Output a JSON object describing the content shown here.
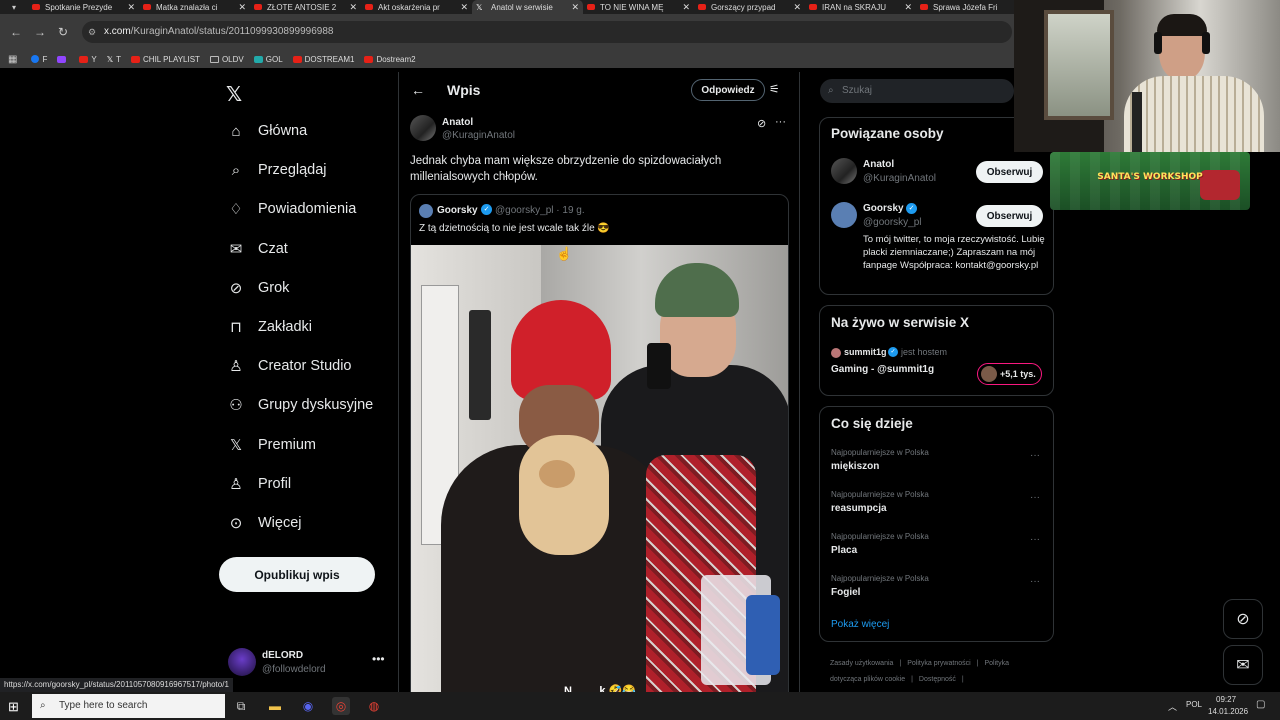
{
  "browser": {
    "tabs": [
      {
        "title": "Spotkanie Prezyde",
        "icon": "youtube-icon",
        "active": false
      },
      {
        "title": "Matka znalazła ci",
        "icon": "youtube-icon",
        "active": false
      },
      {
        "title": "ZŁOTE ANTOSIE 2",
        "icon": "youtube-icon",
        "active": false
      },
      {
        "title": "Akt oskarżenia pr",
        "icon": "youtube-icon",
        "active": false
      },
      {
        "title": "Anatol w serwisie",
        "icon": "x-icon",
        "active": true
      },
      {
        "title": "TO NIE WINA MĘ",
        "icon": "youtube-icon",
        "active": false
      },
      {
        "title": "Gorszący przypad",
        "icon": "youtube-icon",
        "active": false
      },
      {
        "title": "IRAN na SKRAJU",
        "icon": "youtube-icon",
        "active": false
      },
      {
        "title": "Sprawa Józefa Fri",
        "icon": "youtube-icon",
        "active": false
      }
    ],
    "url_host": "x.com",
    "url_path": "/KuraginAnatol/status/2011099930899996988",
    "bookmarks": [
      "F",
      "Y",
      "T",
      "CHIL PLAYLIST",
      "OLDV",
      "GOL",
      "DOSTREAM1",
      "Dostream2"
    ],
    "status_url": "https://x.com/goorsky_pl/status/2011057080916967517/photo/1"
  },
  "nav": {
    "items": [
      "Główna",
      "Przeglądaj",
      "Powiadomienia",
      "Czat",
      "Grok",
      "Zakładki",
      "Creator Studio",
      "Grupy dyskusyjne",
      "Premium",
      "Profil",
      "Więcej"
    ],
    "icons": [
      "home-icon",
      "search-icon",
      "bell-icon",
      "mail-icon",
      "grok-icon",
      "bookmark-icon",
      "creator-icon",
      "groups-icon",
      "x-icon",
      "profile-icon",
      "more-icon"
    ],
    "post_button": "Opublikuj wpis",
    "account_name": "dELORD",
    "account_handle": "@followdelord"
  },
  "main": {
    "title": "Wpis",
    "reply_button": "Odpowiedz",
    "author_name": "Anatol",
    "author_handle": "@KuraginAnatol",
    "text": "Jednak chyba mam większe obrzydzenie do spizdowaciałych millenialsowych chłopów.",
    "quote": {
      "name": "Goorsky",
      "handle": "@goorsky_pl",
      "time": "· 19 g.",
      "text": "Z tą dzietnością to nie jest wcale tak źle 😎"
    },
    "photo_caption": "N.........k 🤣😂"
  },
  "right": {
    "search_placeholder": "Szukaj",
    "related": {
      "title": "Powiązane osoby",
      "people": [
        {
          "name": "Anatol",
          "handle": "@KuraginAnatol",
          "button": "Obserwuj"
        },
        {
          "name": "Goorsky",
          "handle": "@goorsky_pl",
          "button": "Obserwuj",
          "bio": "To mój twitter, to moja rzeczywistość. Lubię placki ziemniaczane;) Zapraszam na mój fanpage Współpraca: kontakt@goorsky.pl"
        }
      ]
    },
    "live": {
      "title": "Na żywo w serwisie X",
      "host_name": "summit1g",
      "host_label": "jest hostem",
      "stream_title": "Gaming - @summit1g",
      "listeners": "+5,1 tys."
    },
    "trends": {
      "title": "Co się dzieje",
      "items": [
        {
          "category": "Najpopularniejsze w Polska",
          "name": "miękiszon"
        },
        {
          "category": "Najpopularniejsze w Polska",
          "name": "reasumpcja"
        },
        {
          "category": "Najpopularniejsze w Polska",
          "name": "Placa"
        },
        {
          "category": "Najpopularniejsze w Polska",
          "name": "Fogiel"
        }
      ],
      "show_more": "Pokaż więcej"
    },
    "footer": [
      "Zasady użytkowania",
      "|",
      "Polityka prywatności",
      "|",
      "Polityka dotycząca plików cookie",
      "|",
      "Dostępność",
      "|"
    ]
  },
  "overlay": {
    "santa_text": "SANTA'S WORKSHOP"
  },
  "taskbar": {
    "search_placeholder": "Type here to search",
    "lang": "POL",
    "time": "09:27",
    "date": "14.01.2026"
  }
}
